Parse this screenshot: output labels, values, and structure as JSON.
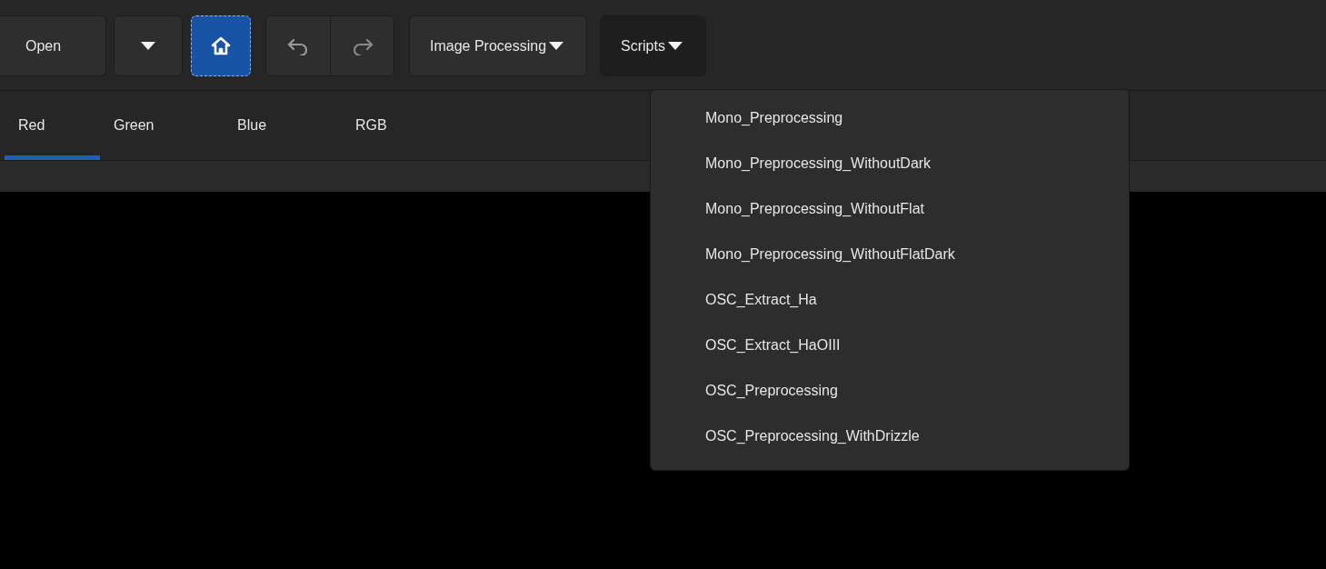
{
  "toolbar": {
    "open_button": {
      "label": "Open"
    },
    "home_button": {
      "active": true
    },
    "menus": [
      {
        "label": "Image Processing",
        "open": false
      },
      {
        "label": "Scripts",
        "open": true,
        "items": [
          "Mono_Preprocessing",
          "Mono_Preprocessing_WithoutDark",
          "Mono_Preprocessing_WithoutFlat",
          "Mono_Preprocessing_WithoutFlatDark",
          "OSC_Extract_Ha",
          "OSC_Extract_HaOIII",
          "OSC_Preprocessing",
          "OSC_Preprocessing_WithDrizzle"
        ]
      }
    ]
  },
  "tabs": [
    {
      "label": "Red",
      "selected": true
    },
    {
      "label": "Green",
      "selected": false
    },
    {
      "label": "Blue",
      "selected": false
    },
    {
      "label": "RGB",
      "selected": false
    }
  ]
}
